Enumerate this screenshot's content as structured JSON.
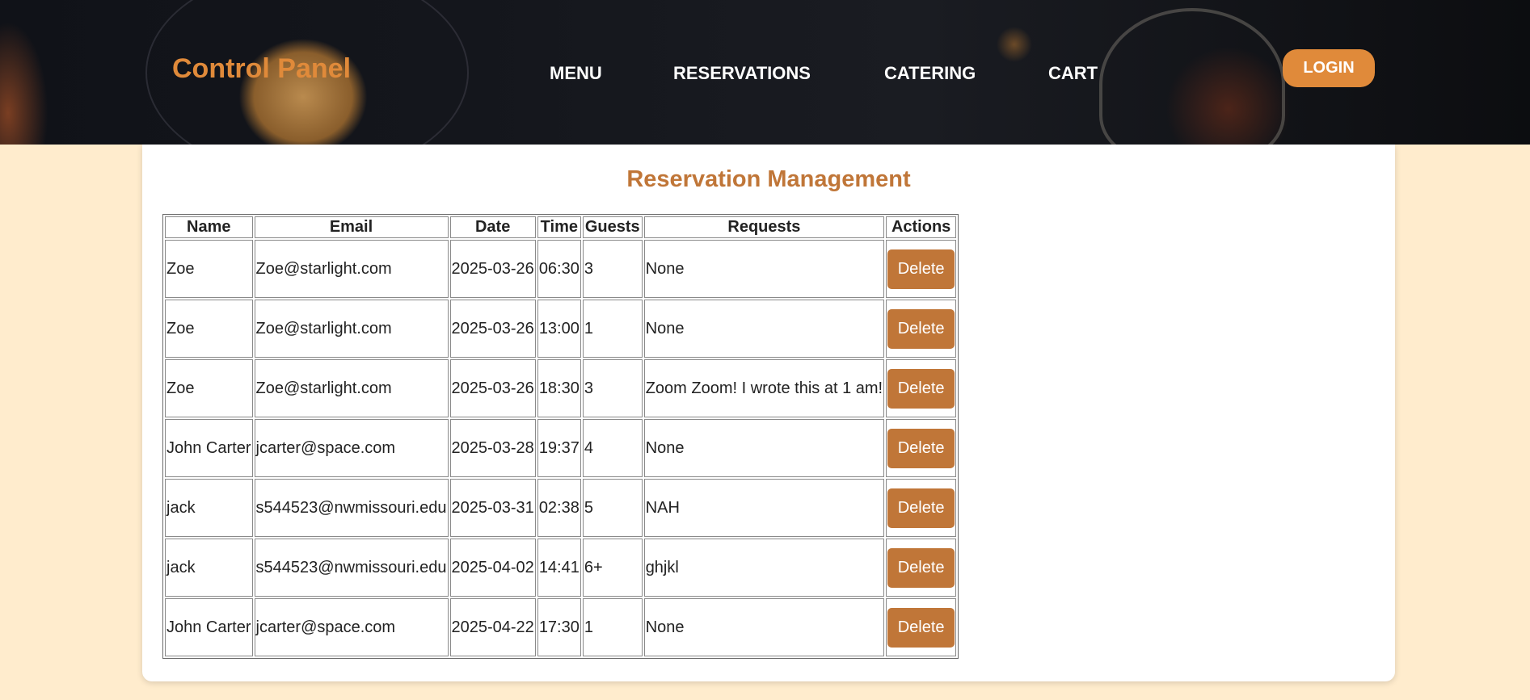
{
  "header": {
    "logo": "Control Panel",
    "nav": [
      "MENU",
      "RESERVATIONS",
      "CATERING",
      "CART"
    ],
    "login_label": "LOGIN"
  },
  "main": {
    "title": "Reservation Management",
    "columns": [
      "Name",
      "Email",
      "Date",
      "Time",
      "Guests",
      "Requests",
      "Actions"
    ],
    "delete_label": "Delete",
    "rows": [
      {
        "name": "Zoe",
        "email": "Zoe@starlight.com",
        "date": "2025-03-26",
        "time": "06:30",
        "guests": "3",
        "requests": "None"
      },
      {
        "name": "Zoe",
        "email": "Zoe@starlight.com",
        "date": "2025-03-26",
        "time": "13:00",
        "guests": "1",
        "requests": "None"
      },
      {
        "name": "Zoe",
        "email": "Zoe@starlight.com",
        "date": "2025-03-26",
        "time": "18:30",
        "guests": "3",
        "requests": "Zoom Zoom! I wrote this at 1 am!"
      },
      {
        "name": "John Carter",
        "email": "jcarter@space.com",
        "date": "2025-03-28",
        "time": "19:37",
        "guests": "4",
        "requests": "None"
      },
      {
        "name": "jack",
        "email": "s544523@nwmissouri.edu",
        "date": "2025-03-31",
        "time": "02:38",
        "guests": "5",
        "requests": "NAH"
      },
      {
        "name": "jack",
        "email": "s544523@nwmissouri.edu",
        "date": "2025-04-02",
        "time": "14:41",
        "guests": "6+",
        "requests": "ghjkl"
      },
      {
        "name": "John Carter",
        "email": "jcarter@space.com",
        "date": "2025-04-22",
        "time": "17:30",
        "guests": "1",
        "requests": "None"
      }
    ]
  }
}
